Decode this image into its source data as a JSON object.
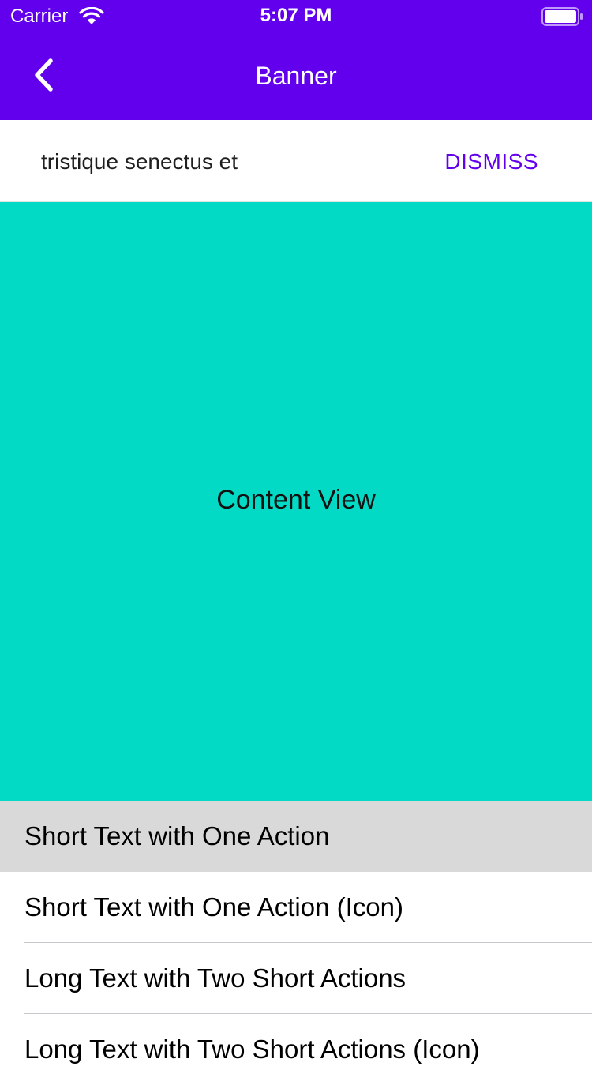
{
  "status_bar": {
    "carrier": "Carrier",
    "time": "5:07 PM",
    "wifi_icon": "wifi-icon",
    "battery_icon": "battery-icon"
  },
  "nav": {
    "title": "Banner",
    "back_icon": "chevron-left-icon"
  },
  "banner": {
    "text": "tristique senectus et",
    "action_label": "DISMISS"
  },
  "content": {
    "label": "Content View"
  },
  "list": {
    "items": [
      {
        "label": "Short Text with One Action",
        "selected": true
      },
      {
        "label": "Short Text with One Action (Icon)",
        "selected": false
      },
      {
        "label": "Long Text with Two Short Actions",
        "selected": false
      },
      {
        "label": "Long Text with Two Short Actions (Icon)",
        "selected": false
      }
    ]
  },
  "colors": {
    "primary": "#6200ee",
    "content_background": "#03dac6",
    "selected_row": "#d9d9d9"
  }
}
